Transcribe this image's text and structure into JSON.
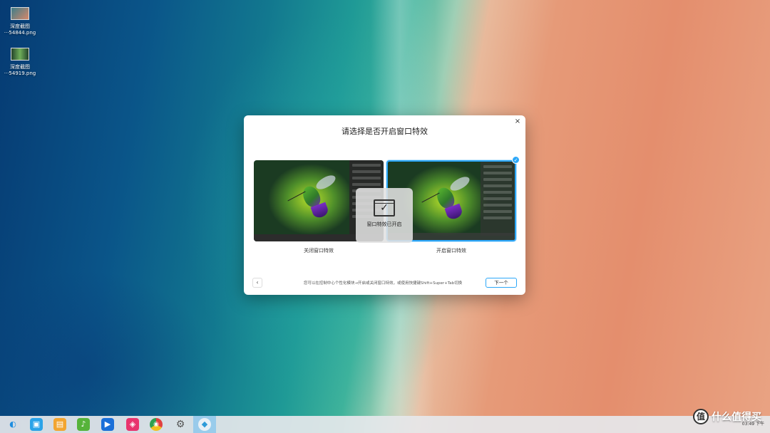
{
  "desktop": {
    "icons": [
      {
        "label_top": "深度截图",
        "label_bottom": "···54844.png",
        "icon": "image-file-icon"
      },
      {
        "label_top": "深度截图",
        "label_bottom": "···54919.png",
        "icon": "image-file-icon"
      }
    ]
  },
  "dialog": {
    "title": "请选择是否开启窗口特效",
    "close_glyph": "×",
    "options": [
      {
        "label": "关闭窗口特效",
        "selected": false
      },
      {
        "label": "开启窗口特效",
        "selected": true
      }
    ],
    "overlay_text": "窗口特效已开启",
    "check_glyph": "✓",
    "back_glyph": "‹",
    "hint": "您可以在控制中心个性化模块→开启或关闭窗口特效，或使用快捷键Shift+Super+Tab切换",
    "next_label": "下一个",
    "accent_color": "#2ca7f8"
  },
  "taskbar": {
    "apps": [
      {
        "name": "launcher",
        "icon": "launcher-icon",
        "color": "#1d8de0",
        "glyph": "◐"
      },
      {
        "name": "app-store",
        "icon": "store-icon",
        "color": "#2aa3e8",
        "glyph": "▣"
      },
      {
        "name": "file-manager",
        "icon": "folder-icon",
        "color": "#f2a530",
        "glyph": "▤"
      },
      {
        "name": "music",
        "icon": "music-icon",
        "color": "#56b33a",
        "glyph": "♪"
      },
      {
        "name": "video",
        "icon": "video-icon",
        "color": "#1a6fd8",
        "glyph": "▶"
      },
      {
        "name": "image-viewer",
        "icon": "image-viewer-icon",
        "color": "#e8346e",
        "glyph": "◈"
      },
      {
        "name": "chrome",
        "icon": "browser-icon",
        "color": "#e8a020",
        "glyph": "◉"
      },
      {
        "name": "settings",
        "icon": "settings-icon",
        "color": "#9a9a9a",
        "glyph": "⚙"
      },
      {
        "name": "welcome",
        "icon": "welcome-icon",
        "color": "#2f9bd8",
        "glyph": "◆"
      }
    ],
    "clock": "03:49 下午"
  },
  "watermark": {
    "logo": "值",
    "text": "什么值得买"
  }
}
